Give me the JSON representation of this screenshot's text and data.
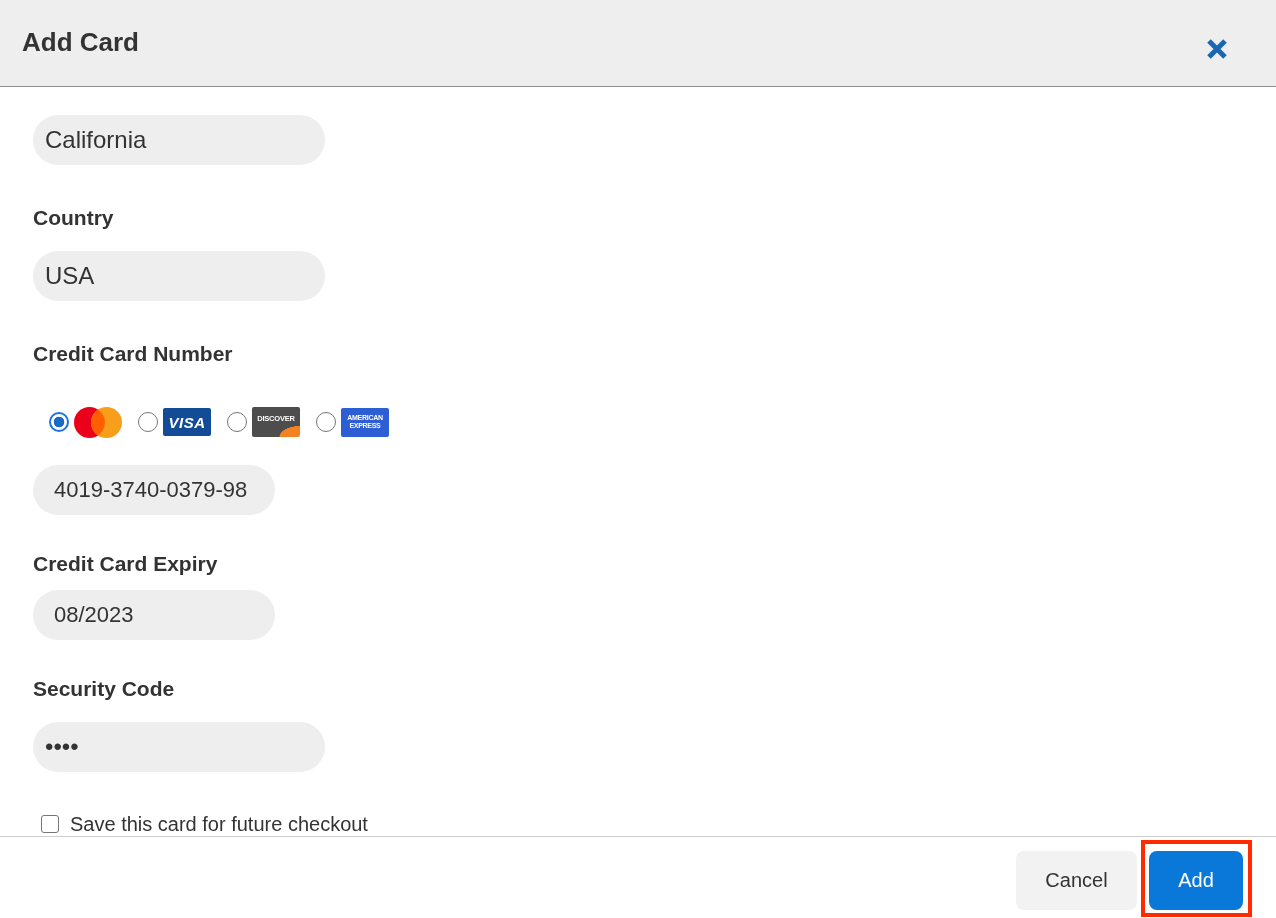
{
  "dialog": {
    "title": "Add Card"
  },
  "fields": [
    {
      "kind": "text",
      "value": "California"
    },
    {
      "kind": "text",
      "label": "Country",
      "value": "USA"
    },
    {
      "kind": "card_number",
      "label": "Credit Card Number",
      "card_types": [
        {
          "kind": "mastercard",
          "selected": true
        },
        {
          "kind": "visa",
          "selected": false,
          "logo_text": "VISA"
        },
        {
          "kind": "discover",
          "selected": false,
          "logo_text": "DISCOVER"
        },
        {
          "kind": "amex",
          "selected": false,
          "logo_text": "AMERICAN EXPRESS"
        }
      ],
      "value": "4019-3740-0379-98"
    },
    {
      "kind": "expiry",
      "label": "Credit Card Expiry",
      "value": "08/2023"
    },
    {
      "kind": "password",
      "label": "Security Code",
      "value": "••••"
    }
  ],
  "save_card": {
    "label": "Save this card for future checkout",
    "checked": false
  },
  "buttons": [
    {
      "label": "Cancel",
      "kind": "secondary",
      "highlighted": false
    },
    {
      "label": "Add",
      "kind": "primary",
      "highlighted": true
    }
  ]
}
